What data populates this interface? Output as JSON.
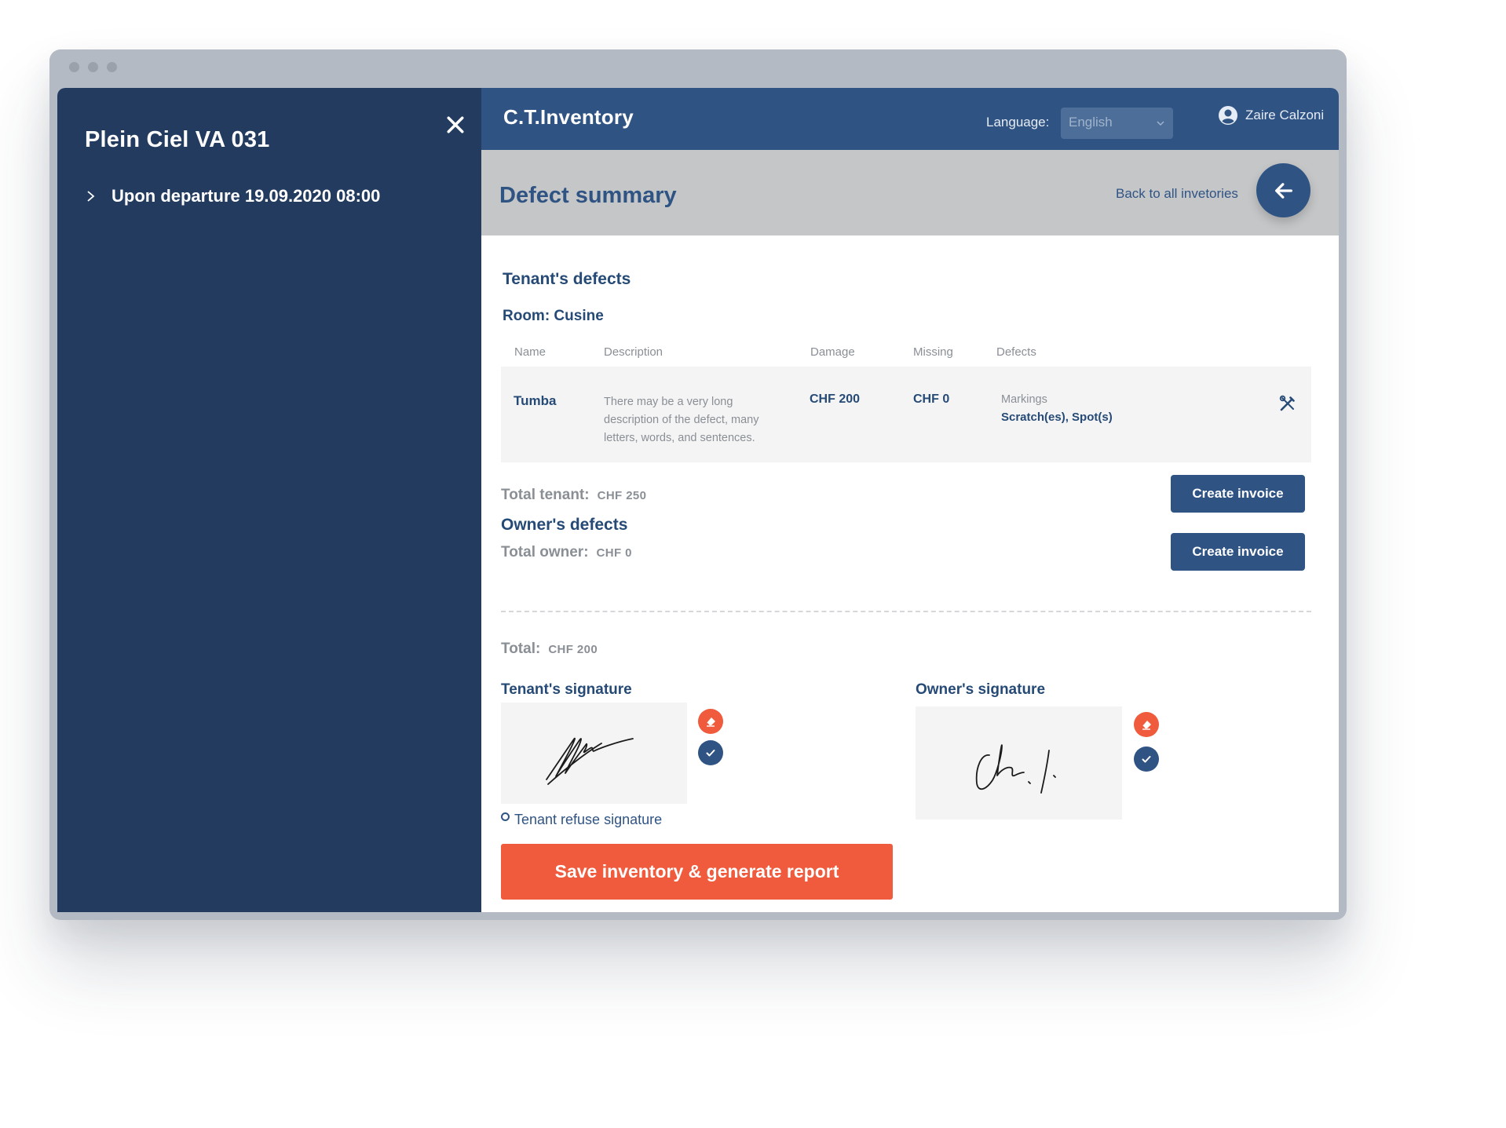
{
  "sidebar": {
    "title": "Plein Ciel VA 031",
    "items": [
      {
        "label": "Upon departure 19.09.2020 08:00"
      }
    ]
  },
  "header": {
    "brand": "C.T.Inventory",
    "language_label": "Language:",
    "language_value": "English",
    "user_name": "Zaire Calzoni"
  },
  "subheader": {
    "title": "Defect summary",
    "back_link": "Back to all invetories"
  },
  "tenant_defects": {
    "title": "Tenant's defects",
    "room": "Room: Cusine",
    "columns": [
      "Name",
      "Description",
      "Damage",
      "Missing",
      "Defects"
    ],
    "rows": [
      {
        "name": "Tumba",
        "description": "There may be a very long description of the defect, many letters, words, and sentences.",
        "damage": "CHF 200",
        "missing": "CHF 0",
        "defect_label": "Markings",
        "defect_list": "Scratch(es), Spot(s)"
      }
    ],
    "total_label": "Total tenant:",
    "total_value": "CHF 250",
    "invoice_button": "Create invoice"
  },
  "owner_defects": {
    "title": "Owner's defects",
    "total_label": "Total owner:",
    "total_value": "CHF 0",
    "invoice_button": "Create invoice"
  },
  "grand_total": {
    "label": "Total:",
    "value": "CHF 200"
  },
  "signatures": {
    "tenant_title": "Tenant's signature",
    "owner_title": "Owner's signature",
    "refuse_label": "Tenant refuse signature"
  },
  "actions": {
    "save_button": "Save inventory & generate report"
  },
  "colors": {
    "sidebar_bg": "#233b5f",
    "header_bg": "#2f5484",
    "subheader_bg": "#c5c6c7",
    "accent_orange": "#ef5b3c",
    "text_navy": "#264a76",
    "muted_gray": "#8a8f96"
  },
  "icons": {
    "close": "close-icon",
    "chevron": "chevron-right-icon",
    "caret": "chevron-down-icon",
    "user": "user-avatar-icon",
    "back": "arrow-left-icon",
    "tools": "tools-icon",
    "erase": "eraser-icon",
    "confirm": "check-icon"
  }
}
